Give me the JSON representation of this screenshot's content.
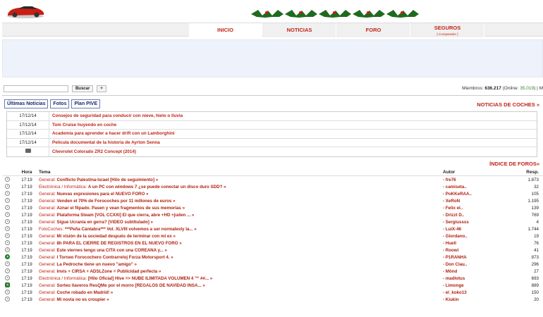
{
  "header": {
    "nav": {
      "inicio": "INICIO",
      "noticias": "NOTICIAS",
      "foro": "FORO",
      "seguros": "SEGUROS",
      "seguros_sub": "[ Comparador ]"
    }
  },
  "search": {
    "button": "Buscar",
    "plus": "+"
  },
  "members": {
    "label": "Miembros:",
    "count": "636.217",
    "online_label": "(Online:",
    "online": "35.019",
    "tail": ") | M"
  },
  "tabs": [
    "Últimas Noticias",
    "Fotos",
    "Plan PIVE"
  ],
  "news_title": "NOTICIAS DE COCHES »",
  "news": [
    {
      "date": "17/12/14",
      "title": "Consejos de seguridad para conducir con nieve, hielo o lluvia"
    },
    {
      "date": "17/12/14",
      "title": "Tom Cruise huyendo en coche"
    },
    {
      "date": "17/12/14",
      "title": "Academia para aprender a hacer drift con un Lamborghini"
    },
    {
      "date": "17/12/14",
      "title": "Película documental de la historia de Ayrton Senna"
    },
    {
      "date": "",
      "title": "Chevrolet Colorado ZR2 Concept (2014)"
    }
  ],
  "forum_index": "ÍNDICE DE FOROS»",
  "forum_headers": {
    "time": "Hora",
    "topic": "Tema",
    "author": "Autor",
    "resp": "Resp."
  },
  "topics": [
    {
      "time": "17:19",
      "cat": "General:",
      "title": "Conflicto Palestina-Israel [Hilo de seguimiento] »",
      "author": "- fre76",
      "resp": "1.873"
    },
    {
      "time": "17:19",
      "cat": "Electrónica / Informática:",
      "title": "A un PC con windows 7 ¿se puede conectar un disco duro SDD? »",
      "author": "- camiseta..",
      "resp": "32"
    },
    {
      "time": "17:19",
      "cat": "General:",
      "title": "Nuevas expresiones para el NUEVO FORO »",
      "author": "- PoKKeRAA..",
      "resp": "105"
    },
    {
      "time": "17:19",
      "cat": "General:",
      "title": "Venden el 70% de Forocoches por 11 millones de euros »",
      "author": "- XeRoN",
      "resp": "1.195"
    },
    {
      "time": "17:19",
      "cat": "General:",
      "title": "Aznar el flipado. Pasen y vean fragmentos de sus memorias »",
      "author": "- Felix el..",
      "resp": "139"
    },
    {
      "time": "17:19",
      "cat": "General:",
      "title": "Plataforma Steam [VOL CCXXI] El que cierra, abre +HD +juden ... »",
      "author": "- Drizzt D..",
      "resp": "769"
    },
    {
      "time": "17:19",
      "cat": "General:",
      "title": "Sigue Ucrania en gerra? [VIDEO subtitulado] »",
      "author": "- Sergiussss",
      "resp": "4"
    },
    {
      "time": "17:19",
      "cat": "FotoCoches:",
      "title": "***Peña Cántabra*** Vol. XLVIII volvemos a ser normalesly la... »",
      "author": "- LuiX-46",
      "resp": "1.744"
    },
    {
      "time": "17:19",
      "cat": "General:",
      "title": "Mi visión de la sociedad después de terminar con mi ex »",
      "author": "- Giordano..",
      "resp": "19"
    },
    {
      "time": "17:19",
      "cat": "General:",
      "title": "8h PARA EL CIERRE DE REGISTROS EN EL NUEVO FORO »",
      "author": "- Huell",
      "resp": "76"
    },
    {
      "time": "17:19",
      "cat": "General:",
      "title": "Este viernes tengo una CITA con una COREANA y... »",
      "author": "- Roowi",
      "resp": "41"
    },
    {
      "time": "17:19",
      "cat": "General:",
      "title": "I Torneo Forocochero Contrarreloj Forza Motorsport 4. »",
      "author": "- P1RANHA",
      "resp": "873"
    },
    {
      "time": "17:19",
      "cat": "General:",
      "title": "La Pedroche tiene un nuevo \"amigo\" »",
      "author": "- Don Clau..",
      "resp": "296"
    },
    {
      "time": "17:19",
      "cat": "General:",
      "title": "Invis + CIRSA + ADSLZone = Publicidad perfecta »",
      "author": "- Mönd",
      "resp": "27"
    },
    {
      "time": "17:19",
      "cat": "Electrónica / Informática:",
      "title": "[Hilo Oficial] Hive => NUBE ILIMITADA VOLUMEN 4 ™ ##... »",
      "author": "- madlotus",
      "resp": "693"
    },
    {
      "time": "17:19",
      "cat": "General:",
      "title": "Sorteo llaveros ResQMe por el morro [REGALOS DE NAVIDAD INSA... »",
      "author": "- Limonge",
      "resp": "889"
    },
    {
      "time": "17:19",
      "cat": "General:",
      "title": "Coche robado en Madrid! »",
      "author": "- el_koko13",
      "resp": "150"
    },
    {
      "time": "17:19",
      "cat": "General:",
      "title": "Mi novia no es croupier »",
      "author": "- Kiukin",
      "resp": "20"
    }
  ],
  "icons": {
    "normal": "play-circle-icon",
    "hot": "hot-topic-icon",
    "pinned": "pinned-topic-icon"
  }
}
